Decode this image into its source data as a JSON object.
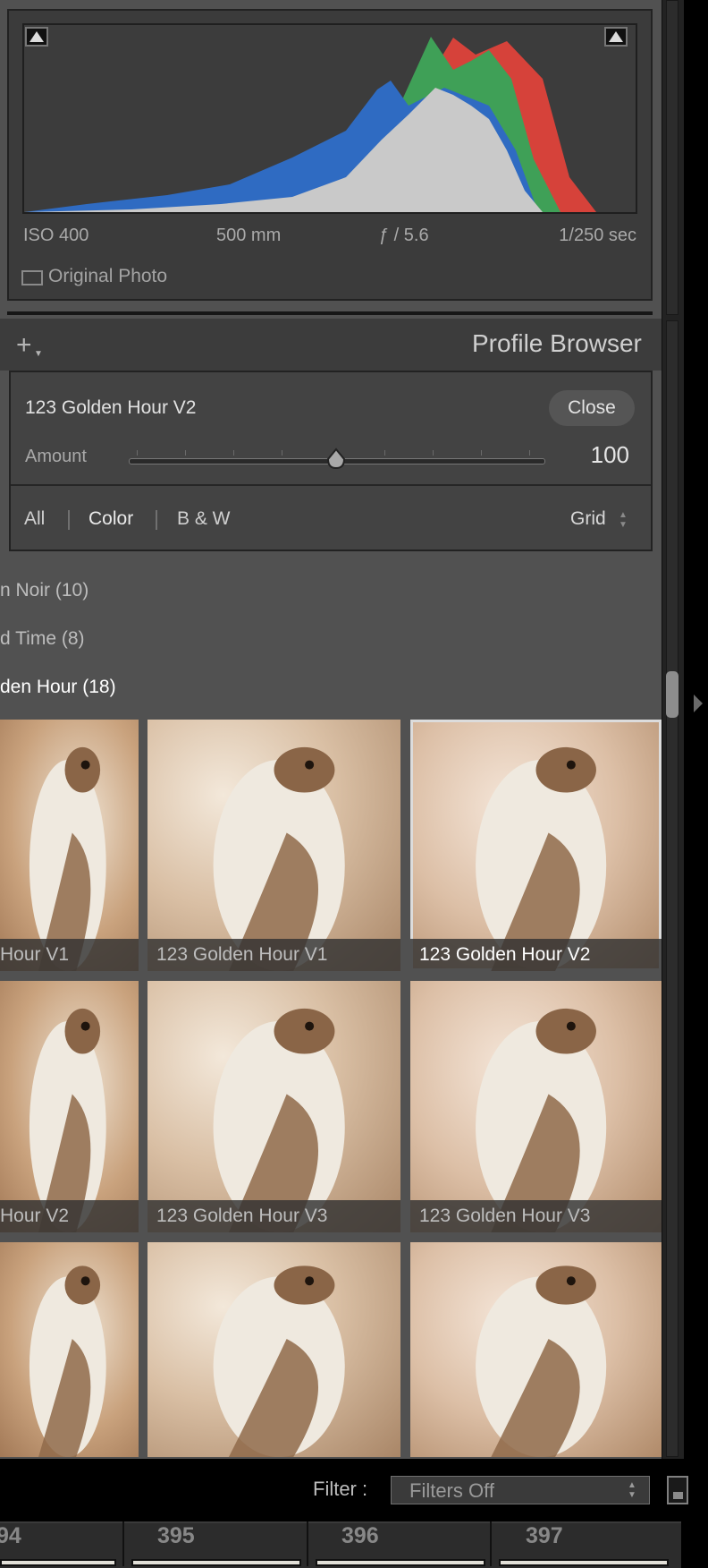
{
  "histogram": {
    "info": {
      "iso": "ISO 400",
      "focal_length": "500 mm",
      "aperture": "ƒ / 5.6",
      "shutter": "1/250 sec"
    },
    "original_photo_label": "Original Photo",
    "original_photo_checked": false,
    "colors": {
      "red": "#d6423a",
      "green": "#3fa057",
      "blue": "#2f6bc2",
      "gray": "#c9c9c9"
    }
  },
  "profile_browser": {
    "title": "Profile Browser",
    "selected_profile": "123 Golden Hour V2",
    "close_label": "Close",
    "amount_label": "Amount",
    "amount_value": "100",
    "amount_fraction": 0.5,
    "filters": [
      "All",
      "Color",
      "B & W"
    ],
    "view_mode": "Grid"
  },
  "groups": [
    {
      "label": "n Noir (10)"
    },
    {
      "label": "d Time (8)"
    },
    {
      "label": "den Hour (18)"
    }
  ],
  "thumbnails": [
    {
      "label": "Hour V1",
      "selected": false
    },
    {
      "label": "123 Golden Hour V1",
      "selected": false
    },
    {
      "label": "123 Golden Hour V2",
      "selected": true
    },
    {
      "label": "Hour V2",
      "selected": false
    },
    {
      "label": "123 Golden Hour V3",
      "selected": false
    },
    {
      "label": "123 Golden Hour V3",
      "selected": false
    },
    {
      "label": "",
      "selected": false
    },
    {
      "label": "",
      "selected": false
    },
    {
      "label": "",
      "selected": false
    }
  ],
  "filter_bar": {
    "label": "Filter :",
    "value": "Filters Off"
  },
  "filmstrip": [
    "94",
    "395",
    "396",
    "397"
  ]
}
